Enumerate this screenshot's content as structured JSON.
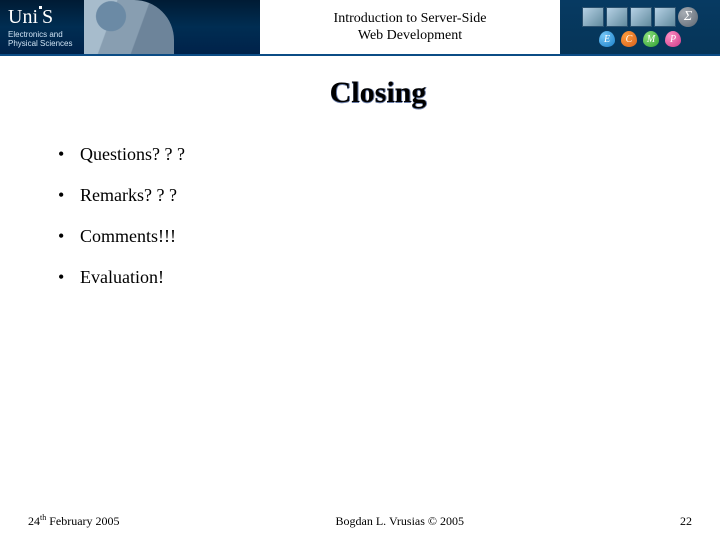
{
  "header": {
    "brand": "Uni",
    "brand_suffix": "S",
    "brand_sub_line1": "Electronics and",
    "brand_sub_line2": "Physical Sciences",
    "course_title_line1": "Introduction to Server-Side",
    "course_title_line2": "Web Development",
    "loz_e": "E",
    "loz_c": "C",
    "loz_m": "M",
    "loz_p": "P",
    "sigma": "Σ"
  },
  "slide": {
    "title": "Closing",
    "bullets": [
      "Questions? ? ?",
      "Remarks? ? ?",
      "Comments!!!",
      "Evaluation!"
    ]
  },
  "footer": {
    "date_day": "24",
    "date_ord": "th",
    "date_rest": " February 2005",
    "author": "Bogdan L. Vrusias © 2005",
    "page": "22"
  }
}
